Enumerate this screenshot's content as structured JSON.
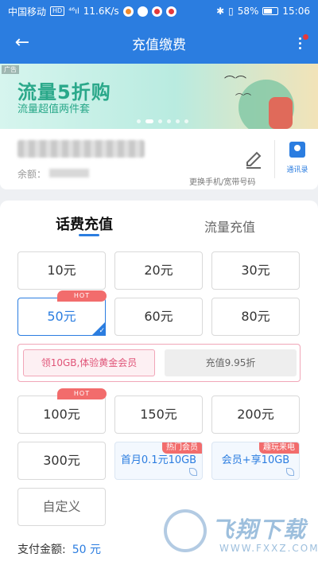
{
  "status_bar": {
    "carrier": "中国移动",
    "hd": "HD",
    "signal": "⁴⁶ıl",
    "speed": "11.6K/s",
    "battery": "58%",
    "time": "15:06"
  },
  "nav": {
    "title": "充值缴费",
    "back_icon": "arrow-left-icon",
    "more_icon": "more-vertical-icon"
  },
  "banner": {
    "ad_label": "广告",
    "headline": "流量5折购",
    "subheadline": "流量超值两件套",
    "slides": 6,
    "active_slide": 1
  },
  "account": {
    "balance_label": "余额：",
    "change_hint": "更换手机/宽带号码",
    "contacts_label": "通讯录"
  },
  "tabs": {
    "active": "话费充值",
    "inactive": "流量充值"
  },
  "amounts": {
    "a10": "10元",
    "a20": "20元",
    "a30": "30元",
    "a50": "50元",
    "a60": "60元",
    "a80": "80元",
    "a100": "100元",
    "a150": "150元",
    "a200": "200元",
    "a300": "300元",
    "custom": "自定义"
  },
  "hot_badge": "HOT",
  "offer": {
    "gold": "领10GB,体验黄金会员",
    "discount": "充值9.95折"
  },
  "packages": {
    "p1_label": "首月0.1元10GB",
    "p1_tag": "热门会员",
    "p2_label": "会员+享10GB",
    "p2_tag": "趣玩来电"
  },
  "payment": {
    "label": "支付金额:",
    "amount": "50 元"
  },
  "watermark": {
    "text": "飞翔下载",
    "url": "WWW.FXXZ.COM"
  },
  "colors": {
    "primary": "#2b7de0",
    "hot": "#f26c6c",
    "pink": "#e05478"
  }
}
